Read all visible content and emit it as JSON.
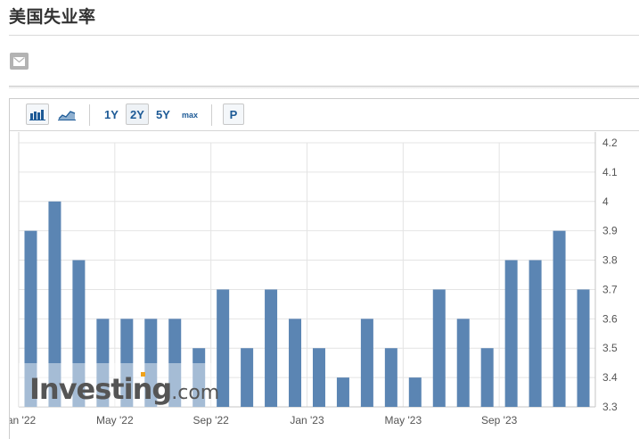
{
  "header": {
    "title": "美国失业率"
  },
  "icons": {
    "mail": "envelope-icon",
    "bar_chart": "bar-chart-icon",
    "area_chart": "area-chart-icon"
  },
  "toolbar": {
    "ranges": [
      {
        "label": "1Y",
        "active": false
      },
      {
        "label": "2Y",
        "active": true
      },
      {
        "label": "5Y",
        "active": false
      },
      {
        "label": "max",
        "active": false
      }
    ],
    "p_label": "P"
  },
  "colors": {
    "bar": "#5b85b3",
    "bar_light": "#a9bfd8",
    "grid": "#e4e4e4",
    "watermark": "#555555",
    "watermark_accent": "#f0a21b"
  },
  "watermark": {
    "text": "Investing",
    "suffix": ".com"
  },
  "chart_data": {
    "type": "bar",
    "title": "",
    "xlabel": "",
    "ylabel": "",
    "categories": [
      "Jan '22",
      "Feb '22",
      "Mar '22",
      "Apr '22",
      "May '22",
      "Jun '22",
      "Jul '22",
      "Aug '22",
      "Sep '22",
      "Oct '22",
      "Nov '22",
      "Dec '22",
      "Jan '23",
      "Feb '23",
      "Mar '23",
      "Apr '23",
      "May '23",
      "Jun '23",
      "Jul '23",
      "Aug '23",
      "Sep '23",
      "Oct '23",
      "Nov '23",
      "Dec '23"
    ],
    "values": [
      3.9,
      4.0,
      3.8,
      3.6,
      3.6,
      3.6,
      3.6,
      3.5,
      3.7,
      3.5,
      3.7,
      3.6,
      3.5,
      3.4,
      3.6,
      3.5,
      3.4,
      3.7,
      3.6,
      3.5,
      3.8,
      3.8,
      3.9,
      3.7
    ],
    "ylim": [
      3.3,
      4.2
    ],
    "y_ticks": [
      "4.2",
      "4.1",
      "4",
      "3.9",
      "3.8",
      "3.7",
      "3.6",
      "3.5",
      "3.4",
      "3.3"
    ],
    "x_tick_labels": [
      {
        "label": "Jan '22",
        "index": 0
      },
      {
        "label": "May '22",
        "index": 4
      },
      {
        "label": "Sep '22",
        "index": 8
      },
      {
        "label": "Jan '23",
        "index": 12
      },
      {
        "label": "May '23",
        "index": 16
      },
      {
        "label": "Sep '23",
        "index": 20
      }
    ],
    "y_axis_side": "right",
    "grid": true
  }
}
